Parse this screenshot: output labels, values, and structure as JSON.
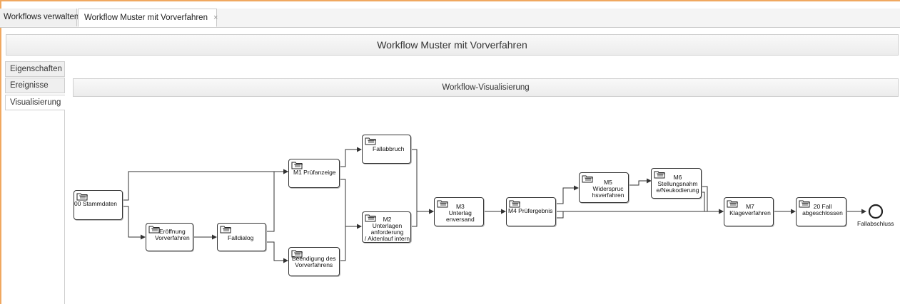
{
  "tabs": [
    {
      "label": "Workflows verwalten"
    },
    {
      "label": "Workflow Muster mit Vorverfahren",
      "close_glyph": "×"
    }
  ],
  "page_title": "Workflow Muster mit Vorverfahren",
  "side_tabs": [
    {
      "label": "Eigenschaften"
    },
    {
      "label": "Ereignisse"
    },
    {
      "label": "Visualisierung"
    }
  ],
  "viz_header": "Workflow-Visualisierung",
  "nodes": {
    "stammdaten": {
      "label": "00 Stammdaten",
      "icon": "folder-icon"
    },
    "eroeffnung": {
      "label": "Eröffnung\nVorverfahren",
      "icon": "folder-icon"
    },
    "falldialog": {
      "label": "Falldialog",
      "icon": "folder-icon"
    },
    "pruefanzeige": {
      "label": "M1 Prüfanzeige",
      "icon": "folder-icon"
    },
    "fallabbruch": {
      "label": "Fallabbruch",
      "icon": "folder-icon"
    },
    "beendigung": {
      "label": "Beendigung des\nVorverfahrens",
      "icon": "folder-icon"
    },
    "unterlagen": {
      "label": "M2\nUnterlagen\nanforderung\n/ Aktenlauf intern",
      "icon": "folder-icon"
    },
    "versand": {
      "label": "M3\nUnterlag\nenversand",
      "icon": "folder-icon"
    },
    "pruefergebnis": {
      "label": "M4 Prüfergebnis",
      "icon": "folder-icon"
    },
    "widerspruch": {
      "label": "M5\nWiderspruc\nhsverfahren",
      "icon": "folder-icon"
    },
    "stellungnahme": {
      "label": "M6\nStellungsnahm\ne/Neukodierung",
      "icon": "folder-icon"
    },
    "klage": {
      "label": "M7\nKlageverfahren",
      "icon": "folder-icon"
    },
    "abgeschlossen": {
      "label": "20 Fall\nabgeschlossen",
      "icon": "folder-icon"
    }
  },
  "end_event": {
    "label": "Fallabschluss"
  },
  "colors": {
    "accent_border": "#f0a860",
    "edge": "#333333"
  }
}
